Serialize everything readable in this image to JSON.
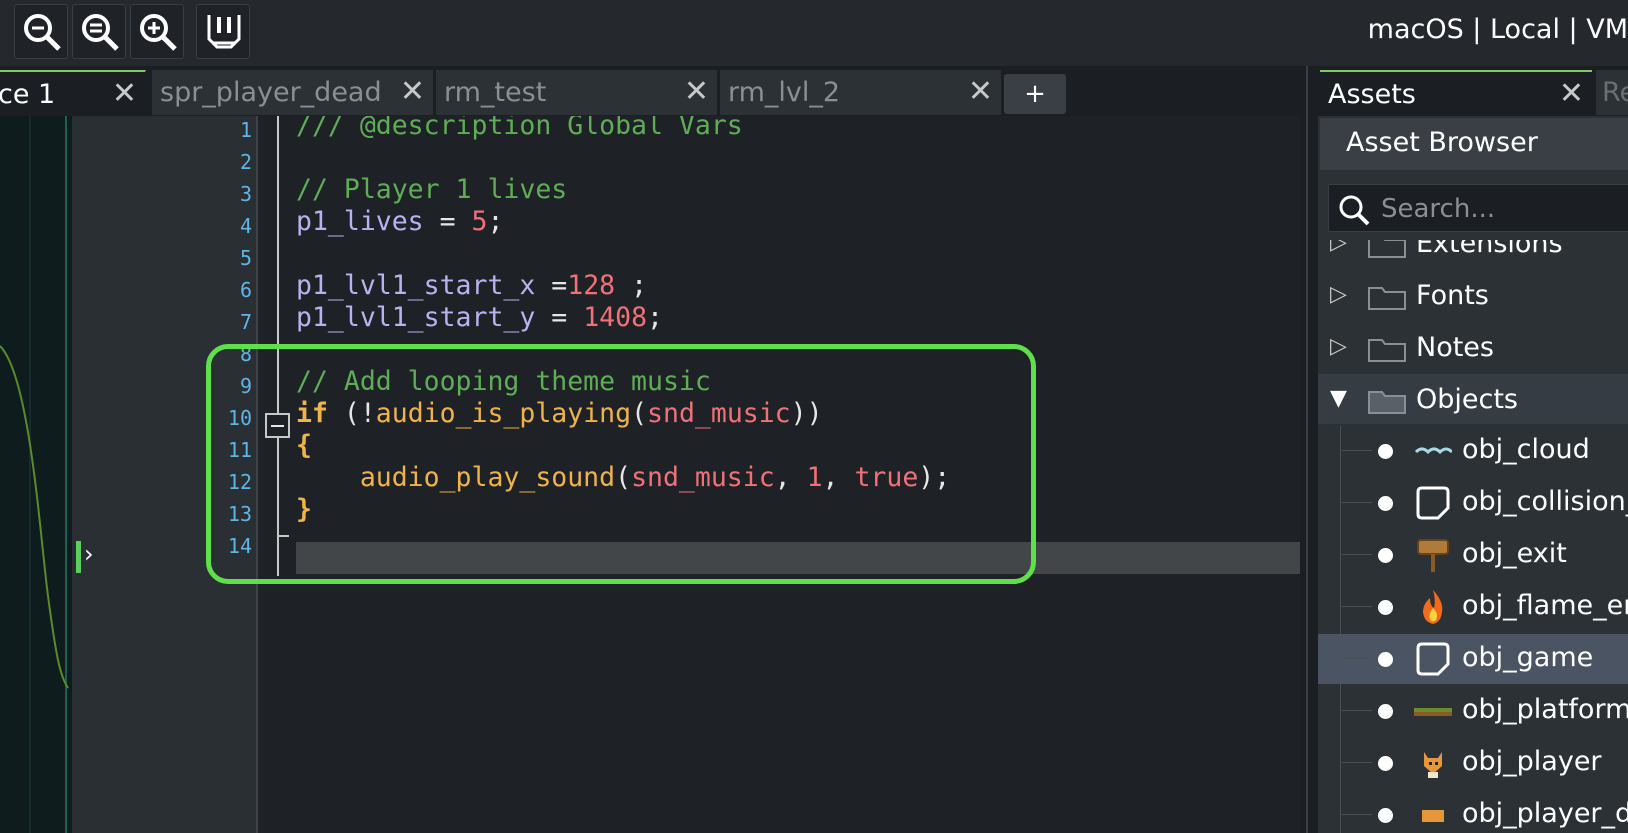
{
  "toolbar": {
    "buttons": [
      "zoom-out-icon",
      "zoom-reset-icon",
      "zoom-in-icon",
      "fit-view-icon"
    ],
    "target_label": "macOS | Local | VM"
  },
  "tabs": [
    {
      "label": "ce 1",
      "active": true
    },
    {
      "label": "spr_player_dead",
      "active": false
    },
    {
      "label": "rm_test",
      "active": false
    },
    {
      "label": "rm_lvl_2",
      "active": false
    }
  ],
  "tab_add_label": "+",
  "tab_close_glyph": "✕",
  "editor": {
    "line_numbers": [
      "1",
      "2",
      "3",
      "4",
      "5",
      "6",
      "7",
      "8",
      "9",
      "10",
      "11",
      "12",
      "13",
      "14"
    ],
    "current_line": "14",
    "code": {
      "l1": "/// @description Global Vars",
      "l3": "// Player 1 lives",
      "l4_var": "p1_lives",
      "l4_op": " = ",
      "l4_num": "5",
      "l4_end": ";",
      "l6_var": "p1_lvl1_start_x",
      "l6_op": " =",
      "l6_num": "128",
      "l6_end": " ;",
      "l7_var": "p1_lvl1_start_y",
      "l7_op": " = ",
      "l7_num": "1408",
      "l7_end": ";",
      "l9": "// Add looping theme music",
      "l10_kw": "if",
      "l10_a": " (!",
      "l10_fn": "audio_is_playing",
      "l10_b": "(",
      "l10_res": "snd_music",
      "l10_c": "))",
      "l11": "{",
      "l12_fn": "    audio_play_sound",
      "l12_a": "(",
      "l12_res": "snd_music",
      "l12_b": ", ",
      "l12_num": "1",
      "l12_c": ", ",
      "l12_true": "true",
      "l12_d": ");",
      "l13": "}"
    }
  },
  "right_panel": {
    "tab_label": "Assets",
    "next_tab_label": "Re",
    "asset_browser_label": "Asset Browser",
    "search_placeholder": "Search...",
    "groups": [
      {
        "label": "Extensions",
        "expanded": false
      },
      {
        "label": "Fonts",
        "expanded": false
      },
      {
        "label": "Notes",
        "expanded": false
      },
      {
        "label": "Objects",
        "expanded": true
      }
    ],
    "objects": [
      {
        "label": "obj_cloud",
        "icon": "cloud-sprite-icon",
        "selected": false
      },
      {
        "label": "obj_collision_",
        "icon": "object-default-icon",
        "selected": false
      },
      {
        "label": "obj_exit",
        "icon": "exit-sign-icon",
        "selected": false
      },
      {
        "label": "obj_flame_en",
        "icon": "flame-icon",
        "selected": false
      },
      {
        "label": "obj_game",
        "icon": "object-default-icon",
        "selected": true
      },
      {
        "label": "obj_platform",
        "icon": "platform-sprite-icon",
        "selected": false
      },
      {
        "label": "obj_player",
        "icon": "fox-sprite-icon",
        "selected": false
      },
      {
        "label": "obj_player_d",
        "icon": "fox-dead-sprite-icon",
        "selected": false
      }
    ]
  },
  "colors": {
    "highlight_box": "#5fe04a",
    "comment": "#5fad56",
    "keyword": "#f0b34a",
    "number": "#f07178",
    "variable": "#b7b3f0",
    "line_number": "#5fb4e8",
    "selected_row": "#4b5462"
  }
}
